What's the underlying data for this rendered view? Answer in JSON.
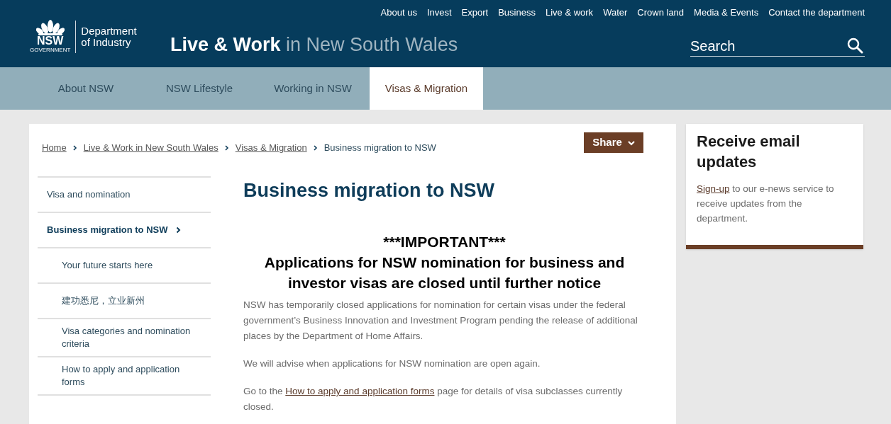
{
  "top_links": [
    "About us",
    "Invest",
    "Export",
    "Business",
    "Live & work",
    "Water",
    "Crown land",
    "Media & Events",
    "Contact the department"
  ],
  "logo": {
    "mark": "NSW",
    "sub": "GOVERNMENT",
    "department": "Department of Industry"
  },
  "site_title": {
    "strong": "Live & Work",
    "rest": "in New South Wales"
  },
  "search": {
    "placeholder": "Search"
  },
  "tabs": [
    {
      "label": "About NSW",
      "selected": false
    },
    {
      "label": "NSW Lifestyle",
      "selected": false
    },
    {
      "label": "Working in NSW",
      "selected": false
    },
    {
      "label": "Visas & Migration",
      "selected": true
    }
  ],
  "breadcrumb": [
    {
      "label": "Home",
      "current": false
    },
    {
      "label": "Live & Work in New South Wales",
      "current": false
    },
    {
      "label": "Visas & Migration",
      "current": false
    },
    {
      "label": "Business migration to NSW",
      "current": true
    }
  ],
  "share_button": "Share",
  "side_nav": [
    {
      "label": "Visa and nomination",
      "selected": false
    },
    {
      "label": "Business migration to NSW",
      "selected": true,
      "expanded": true,
      "children": [
        {
          "label": "Your future starts here",
          "selected": false
        },
        {
          "label": "建功悉尼，立业新州",
          "selected": false
        },
        {
          "label": "Visa categories and nomination criteria",
          "selected": false
        },
        {
          "label": "How to apply and application forms",
          "selected": false
        }
      ]
    }
  ],
  "page_title": "Business migration to NSW",
  "notice": [
    "***IMPORTANT***",
    "Applications for NSW nomination for business and investor visas are closed until further notice"
  ],
  "paragraphs": [
    [
      {
        "kind": "text",
        "text": "NSW has temporarily closed applications for nomination for certain visas under the federal government’s Business Innovation and Investment Program pending the release of additional places by the Department of Home Affairs."
      }
    ],
    [
      {
        "kind": "text",
        "text": "We will advise when applications for NSW nomination are open again."
      }
    ],
    [
      {
        "kind": "text",
        "text": "Go to the"
      },
      {
        "kind": "link",
        "text": "How to apply and application forms"
      },
      {
        "kind": "text",
        "text": "page for details of visa subclasses currently closed."
      }
    ]
  ],
  "email_card": {
    "title": "Receive email updates",
    "body": [
      {
        "kind": "link",
        "text": "Sign-up"
      },
      {
        "kind": "text",
        "text": "to our e-news service to receive updates from the department."
      }
    ]
  }
}
